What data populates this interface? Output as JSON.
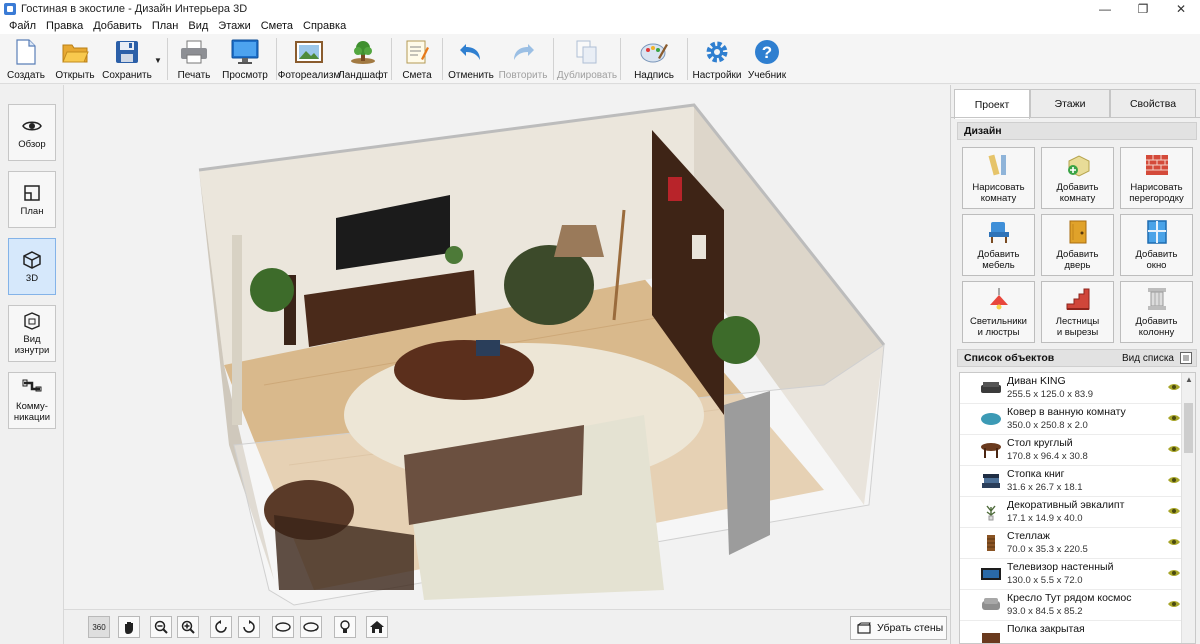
{
  "window": {
    "title": "Гостиная в экостиле - Дизайн Интерьера 3D",
    "controls": {
      "minimize": "—",
      "maximize": "❐",
      "close": "✕"
    }
  },
  "menu": [
    "Файл",
    "Правка",
    "Добавить",
    "План",
    "Вид",
    "Этажи",
    "Смета",
    "Справка"
  ],
  "toolbar": {
    "create": "Создать",
    "open": "Открыть",
    "save": "Сохранить",
    "print": "Печать",
    "preview": "Просмотр",
    "photorealism": "Фотореализм",
    "landscape": "Ландшафт",
    "estimate": "Смета",
    "undo": "Отменить",
    "redo": "Повторить",
    "duplicate": "Дублировать",
    "label": "Надпись",
    "settings": "Настройки",
    "tutorial": "Учебник",
    "dropdown": "▼"
  },
  "left_panel": {
    "overview": "Обзор",
    "plan": "План",
    "view3d": "3D",
    "inside_line1": "Вид",
    "inside_line2": "изнутри",
    "utilities_line1": "Комму-",
    "utilities_line2": "никации"
  },
  "bottom_bar": {
    "rotate360": "360",
    "remove_walls": "Убрать стены"
  },
  "right_panel": {
    "tabs": [
      "Проект",
      "Этажи",
      "Свойства"
    ],
    "design_header": "Дизайн",
    "design_buttons": [
      {
        "l1": "Нарисовать",
        "l2": "комнату"
      },
      {
        "l1": "Добавить",
        "l2": "комнату"
      },
      {
        "l1": "Нарисовать",
        "l2": "перегородку"
      },
      {
        "l1": "Добавить",
        "l2": "мебель"
      },
      {
        "l1": "Добавить",
        "l2": "дверь"
      },
      {
        "l1": "Добавить",
        "l2": "окно"
      },
      {
        "l1": "Светильники",
        "l2": "и люстры"
      },
      {
        "l1": "Лестницы",
        "l2": "и вырезы"
      },
      {
        "l1": "Добавить",
        "l2": "колонну"
      }
    ],
    "objects_header": "Список объектов",
    "list_view": "Вид списка",
    "objects": [
      {
        "name": "Диван KING",
        "dims": "255.5 x 125.0 x 83.9"
      },
      {
        "name": "Ковер в ванную комнату",
        "dims": "350.0 x 250.8 x 2.0"
      },
      {
        "name": "Стол круглый",
        "dims": "170.8 x 96.4 x 30.8"
      },
      {
        "name": "Стопка книг",
        "dims": "31.6 x 26.7 x 18.1"
      },
      {
        "name": "Декоративный эвкалипт",
        "dims": "17.1 x 14.9 x 40.0"
      },
      {
        "name": "Стеллаж",
        "dims": "70.0 x 35.3 x 220.5"
      },
      {
        "name": "Телевизор настенный",
        "dims": "130.0 x 5.5 x 72.0"
      },
      {
        "name": "Кресло Тут рядом космос",
        "dims": "93.0 x 84.5 x 85.2"
      },
      {
        "name": "Полка закрытая",
        "dims": ""
      }
    ]
  },
  "colors": {
    "accent": "#3a7bd5",
    "active_tool": "#d6e8fb",
    "floor": "#d9b98c",
    "wall": "#ebe6dc",
    "rug": "#ede6d6",
    "wood": "#4a2a1a"
  }
}
